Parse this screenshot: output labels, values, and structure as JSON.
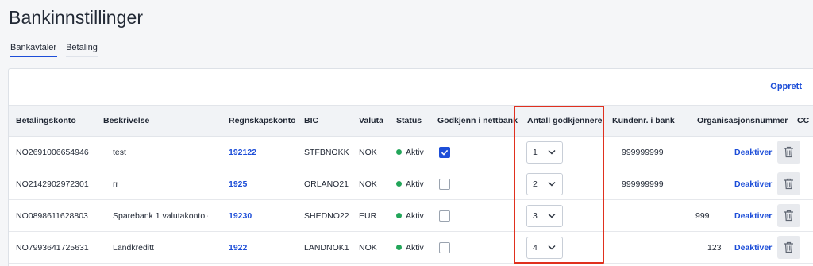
{
  "page": {
    "title": "Bankinnstillinger"
  },
  "tabs": [
    {
      "label": "Bankavtaler",
      "active": true
    },
    {
      "label": "Betaling",
      "active": false
    }
  ],
  "toolbar": {
    "create_label": "Opprett"
  },
  "columns": {
    "account": "Betalingskonto",
    "description": "Beskrivelse",
    "ledger": "Regnskapskonto",
    "bic": "BIC",
    "currency": "Valuta",
    "status": "Status",
    "approve_online": "Godkjenn i nettbank",
    "approvers": "Antall godkjennere",
    "customer_no": "Kundenr. i bank",
    "org_no": "Organisasjonsnummer",
    "cc": "CC"
  },
  "rows": [
    {
      "account": "NO2691006654946",
      "description": "test",
      "ledger": "192122",
      "bic": "STFBNOKK",
      "currency": "NOK",
      "status": "Aktiv",
      "approve_online": true,
      "approvers": "1",
      "customer_no": "999999999",
      "org_no": "",
      "action": "Deaktiver"
    },
    {
      "account": "NO2142902972301",
      "description": "rr",
      "ledger": "1925",
      "bic": "ORLANO21",
      "currency": "NOK",
      "status": "Aktiv",
      "approve_online": false,
      "approvers": "2",
      "customer_no": "999999999",
      "org_no": "",
      "action": "Deaktiver"
    },
    {
      "account": "NO0898611628803",
      "description": "Sparebank 1 valutakonto -",
      "ledger": "19230",
      "bic": "SHEDNO22",
      "currency": "EUR",
      "status": "Aktiv",
      "approve_online": false,
      "approvers": "3",
      "customer_no": "",
      "org_no": "999",
      "action": "Deaktiver"
    },
    {
      "account": "NO7993641725631",
      "description": "Landkreditt",
      "ledger": "1922",
      "bic": "LANDNOK1",
      "currency": "NOK",
      "status": "Aktiv",
      "approve_online": false,
      "approvers": "4",
      "customer_no": "",
      "org_no": "123-",
      "action": "Deaktiver"
    }
  ],
  "colors": {
    "accent": "#1d4ed8",
    "status_active": "#22a559",
    "highlight": "#e0301e"
  },
  "icons": {
    "select": "chevron-down-icon",
    "delete": "trash-icon",
    "checked": "checkmark-icon",
    "status": "status-dot-icon"
  }
}
